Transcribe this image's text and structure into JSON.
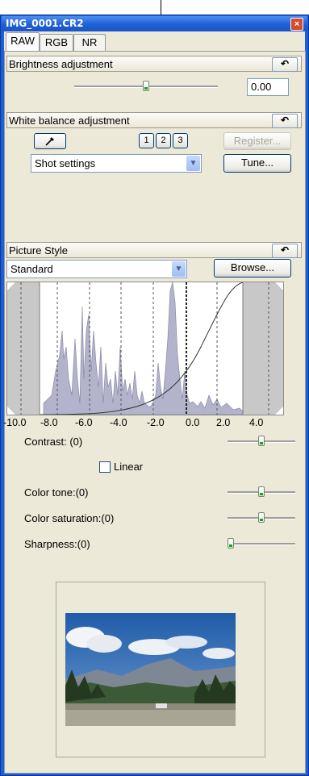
{
  "window": {
    "title": "IMG_0001.CR2",
    "close_label": "×"
  },
  "tabs": [
    {
      "label": "RAW",
      "active": true
    },
    {
      "label": "RGB",
      "active": false
    },
    {
      "label": "NR",
      "active": false
    }
  ],
  "brightness": {
    "header": "Brightness adjustment",
    "value": "0.00",
    "slider_fraction": 0.5
  },
  "white_balance": {
    "header": "White balance adjustment",
    "preset_buttons": [
      "1",
      "2",
      "3"
    ],
    "register_label": "Register...",
    "selected": "Shot settings",
    "tune_label": "Tune..."
  },
  "picture_style": {
    "header": "Picture Style",
    "selected": "Standard",
    "browse_label": "Browse...",
    "scale_labels": [
      "-10.0",
      "-8.0",
      "-6.0",
      "-4.0",
      "-2.0",
      "0.0",
      "2.0",
      "4.0"
    ],
    "contrast_label": "Contrast: (0)",
    "linear_label": "Linear",
    "color_tone_label": "Color tone:(0)",
    "color_saturation_label": "Color saturation:(0)",
    "sharpness_label": "Sharpness:(0)",
    "contrast_fraction": 0.5,
    "color_tone_fraction": 0.5,
    "color_saturation_fraction": 0.5,
    "sharpness_fraction": 0.0
  },
  "icons": {
    "reset": "undo-arrow-icon",
    "eyedropper": "eyedropper-icon",
    "dropdown": "chevron-down-icon"
  },
  "colors": {
    "titlebar": "#1f5fd5",
    "panel": "#ece9d8",
    "histogram_fill": "#b3b3cc",
    "slider_accent": "#21a121"
  }
}
